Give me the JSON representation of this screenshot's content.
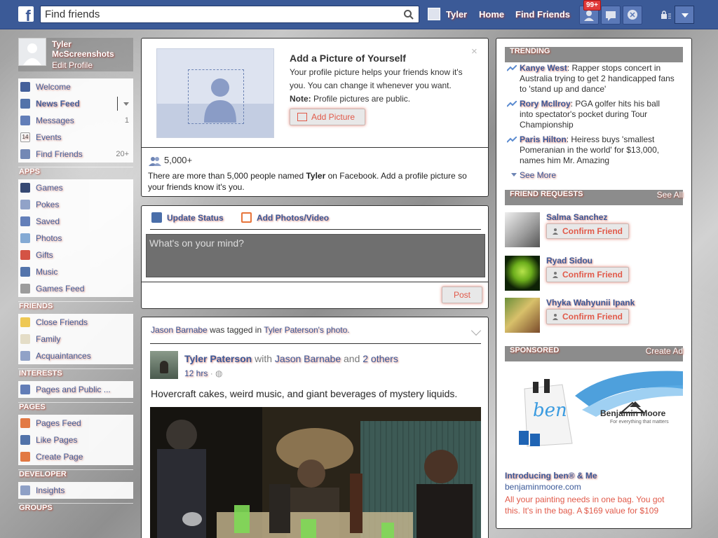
{
  "topbar": {
    "search_placeholder": "Find friends",
    "user_name": "Tyler",
    "home": "Home",
    "find_friends": "Find Friends",
    "notification_badge": "99+"
  },
  "profile": {
    "name": "Tyler McScreenshots",
    "edit": "Edit Profile"
  },
  "nav": {
    "favorites": [
      {
        "label": "Welcome",
        "count": "",
        "icon": "facebook-icon"
      },
      {
        "label": "News Feed",
        "count": "",
        "icon": "newsfeed-icon"
      },
      {
        "label": "Messages",
        "count": "1",
        "icon": "messages-icon"
      },
      {
        "label": "Events",
        "count": "",
        "icon": "calendar-icon"
      },
      {
        "label": "Find Friends",
        "count": "20+",
        "icon": "find-friends-icon"
      }
    ],
    "apps_title": "APPS",
    "apps": [
      {
        "label": "Games",
        "icon": "games-icon"
      },
      {
        "label": "Pokes",
        "icon": "pokes-icon"
      },
      {
        "label": "Saved",
        "icon": "bookmark-icon"
      },
      {
        "label": "Photos",
        "icon": "photos-icon"
      },
      {
        "label": "Gifts",
        "icon": "gift-icon"
      },
      {
        "label": "Music",
        "icon": "music-icon"
      },
      {
        "label": "Games Feed",
        "icon": "gamepad-icon"
      }
    ],
    "friends_title": "FRIENDS",
    "friends": [
      {
        "label": "Close Friends",
        "icon": "star-icon"
      },
      {
        "label": "Family",
        "icon": "family-icon"
      },
      {
        "label": "Acquaintances",
        "icon": "acquaintances-icon"
      }
    ],
    "interests_title": "INTERESTS",
    "interests": [
      {
        "label": "Pages and Public ...",
        "icon": "rss-icon"
      }
    ],
    "pages_title": "PAGES",
    "pages": [
      {
        "label": "Pages Feed",
        "icon": "megaphone-icon"
      },
      {
        "label": "Like Pages",
        "icon": "like-icon"
      },
      {
        "label": "Create Page",
        "icon": "create-page-icon"
      }
    ],
    "developer_title": "DEVELOPER",
    "developer": [
      {
        "label": "Insights",
        "icon": "insights-icon"
      }
    ],
    "groups_title": "GROUPS"
  },
  "add_picture": {
    "title": "Add a Picture of Yourself",
    "description": "Your profile picture helps your friends know it's you. You can change it whenever you want.",
    "note_label": "Note:",
    "note_text": " Profile pictures are public.",
    "button": "Add Picture",
    "close": "×",
    "people_count": "5,000+",
    "notice_pre": "There are more than 5,000 people named ",
    "notice_name": "Tyler",
    "notice_post": " on Facebook. Add a profile picture so your friends know it's you."
  },
  "composer": {
    "update_status": "Update Status",
    "add_photos": "Add Photos/Video",
    "placeholder": "What's on your mind?",
    "post": "Post"
  },
  "feed": {
    "story_actor": "Jason Barnabe",
    "story_mid": " was tagged in ",
    "story_target": "Tyler Paterson's photo.",
    "author": "Tyler Paterson",
    "with": " with ",
    "tagged": "Jason Barnabe",
    "and": " and ",
    "others": "2 others",
    "time": "12 hrs",
    "caption": "Hovercraft cakes, weird music, and giant beverages of mystery liquids."
  },
  "trending": {
    "title": "TRENDING",
    "items": [
      {
        "name": "Kanye West",
        "text": ": Rapper stops concert in Australia trying to get 2 handicapped fans to 'stand up and dance'"
      },
      {
        "name": "Rory McIlroy",
        "text": ": PGA golfer hits his ball into spectator's pocket during Tour Championship"
      },
      {
        "name": "Paris Hilton",
        "text": ": Heiress buys 'smallest Pomeranian in the world' for $13,000, names him Mr. Amazing"
      }
    ],
    "see_more": "See More"
  },
  "friend_requests": {
    "title": "FRIEND REQUESTS",
    "see_all": "See All",
    "items": [
      {
        "name": "Salma Sanchez",
        "button": "Confirm Friend"
      },
      {
        "name": "Ryad Sidou",
        "button": "Confirm Friend"
      },
      {
        "name": "Vhyka Wahyunii Ipank",
        "button": "Confirm Friend"
      }
    ]
  },
  "sponsored": {
    "title": "SPONSORED",
    "create_ad": "Create Ad",
    "bag_text": "ben",
    "brand": "Benjamin Moore",
    "tagline": "For everything that matters",
    "ad_title": "Introducing ben® & Me",
    "ad_url": "benjaminmoore.com",
    "ad_text": "All your painting needs in one bag. You got this. It's in the bag. A $169 value for $109"
  },
  "colors": {
    "brand_blue": "#3b5998",
    "topbar": "#3b5a97",
    "accent_red": "#e15a4a"
  }
}
